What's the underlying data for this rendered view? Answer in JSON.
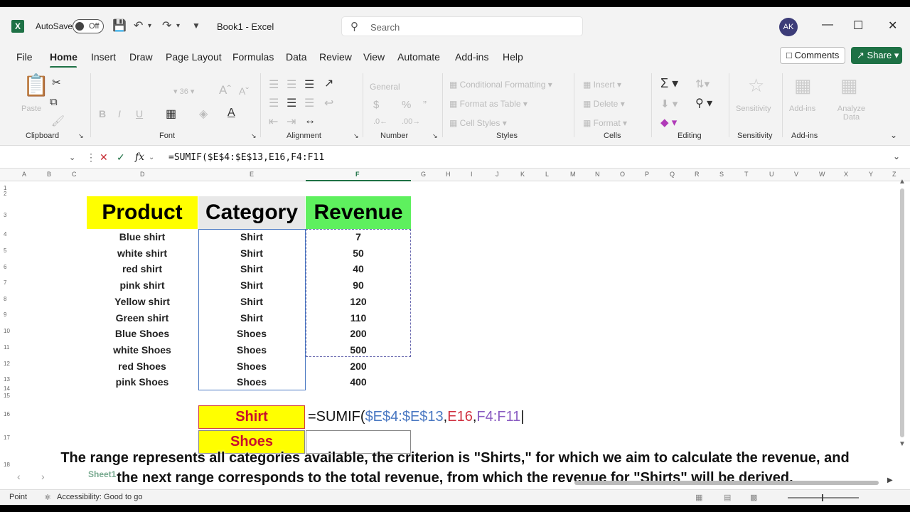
{
  "titlebar": {
    "app_icon": "X",
    "autosave_label": "AutoSave",
    "autosave_state": "Off",
    "doc_title": "Book1  -  Excel",
    "search_placeholder": "Search",
    "avatar": "AK"
  },
  "menu": {
    "items": [
      "File",
      "Home",
      "Insert",
      "Draw",
      "Page Layout",
      "Formulas",
      "Data",
      "Review",
      "View",
      "Automate",
      "Add-ins",
      "Help"
    ],
    "comments": "Comments",
    "share": "Share"
  },
  "ribbon": {
    "groups": [
      "Clipboard",
      "Font",
      "Alignment",
      "Number",
      "Styles",
      "Cells",
      "Editing",
      "Sensitivity",
      "Add-ins"
    ],
    "paste": "Paste",
    "number_format": "General",
    "conditional_formatting": "Conditional Formatting",
    "format_as_table": "Format as Table",
    "cell_styles": "Cell Styles",
    "insert": "Insert",
    "delete": "Delete",
    "format": "Format",
    "sensitivity": "Sensitivity",
    "addins": "Add-ins",
    "analyze": "Analyze Data"
  },
  "formula_bar": {
    "fx": "fx",
    "formula": "=SUMIF($E$4:$E$13,E16,F4:F11"
  },
  "columns": [
    "A",
    "B",
    "C",
    "D",
    "E",
    "F",
    "G",
    "H",
    "I",
    "J",
    "K",
    "L",
    "M",
    "N",
    "O",
    "P",
    "Q",
    "R",
    "S",
    "T",
    "U",
    "V",
    "W",
    "X",
    "Y",
    "Z"
  ],
  "rows": [
    "1",
    "2",
    "3",
    "4",
    "5",
    "6",
    "7",
    "8",
    "9",
    "10",
    "11",
    "12",
    "13",
    "14",
    "15",
    "16",
    "17",
    "18"
  ],
  "table": {
    "headers": {
      "product": "Product",
      "category": "Category",
      "revenue": "Revenue"
    },
    "rows": [
      {
        "product": "Blue shirt",
        "category": "Shirt",
        "revenue": "7"
      },
      {
        "product": "white shirt",
        "category": "Shirt",
        "revenue": "50"
      },
      {
        "product": "red shirt",
        "category": "Shirt",
        "revenue": "40"
      },
      {
        "product": "pink shirt",
        "category": "Shirt",
        "revenue": "90"
      },
      {
        "product": "Yellow shirt",
        "category": "Shirt",
        "revenue": "120"
      },
      {
        "product": "Green shirt",
        "category": "Shirt",
        "revenue": "110"
      },
      {
        "product": "Blue Shoes",
        "category": "Shoes",
        "revenue": "200"
      },
      {
        "product": "white Shoes",
        "category": "Shoes",
        "revenue": "500"
      },
      {
        "product": "red Shoes",
        "category": "Shoes",
        "revenue": "200"
      },
      {
        "product": "pink Shoes",
        "category": "Shoes",
        "revenue": "400"
      }
    ]
  },
  "summary": {
    "shirt_label": "Shirt",
    "shoes_label": "Shoes",
    "formula_parts": {
      "prefix": "=SUMIF(",
      "range1": "$E$4:$E$13",
      "comma1": ",",
      "criterion": "E16",
      "comma2": ",",
      "range2": "F4:F11"
    }
  },
  "caption": {
    "line1": "The range represents all categories available, the criterion is \"Shirts,\" for which we aim to calculate the revenue, and",
    "line2": "the next range corresponds to the total revenue, from which the revenue for \"Shirts\" will be derived."
  },
  "status": {
    "mode": "Point",
    "accessibility": "Accessibility: Good to go",
    "sheet_tab": "Sheet1"
  },
  "colors": {
    "excel_green": "#1e7145",
    "header_yellow": "#ffff00",
    "header_grey": "#e8e8e8",
    "header_green": "#5ef05e",
    "ref_blue": "#4a78c2",
    "ref_red": "#d03040",
    "ref_purple": "#8a5cc2"
  }
}
